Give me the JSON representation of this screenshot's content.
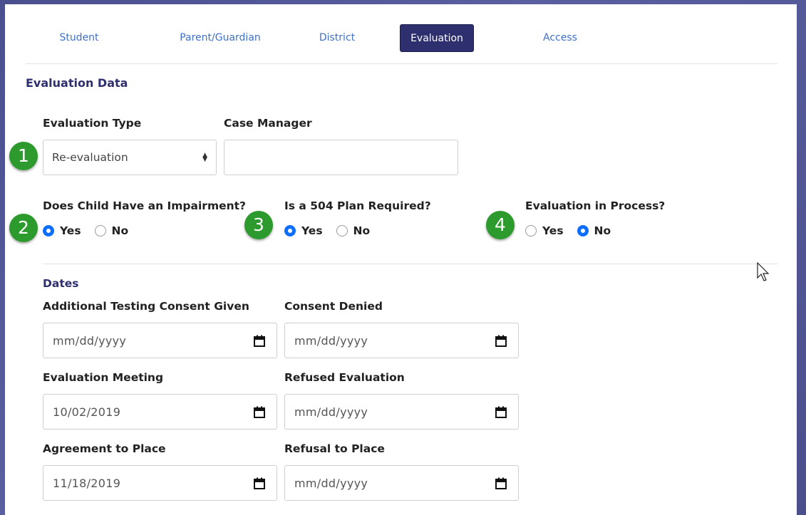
{
  "tabs": [
    "Student",
    "Parent/Guardian",
    "District",
    "Evaluation",
    "Access"
  ],
  "active_tab": "Evaluation",
  "section_title": "Evaluation Data",
  "evaluation_type": {
    "label": "Evaluation Type",
    "value": "Re-evaluation"
  },
  "case_manager": {
    "label": "Case Manager",
    "value": ""
  },
  "badges": [
    "1",
    "2",
    "3",
    "4"
  ],
  "impairment": {
    "label": "Does Child Have an Impairment?",
    "yes": "Yes",
    "no": "No",
    "selected": "Yes"
  },
  "plan504": {
    "label": "Is a 504 Plan Required?",
    "yes": "Yes",
    "no": "No",
    "selected": "Yes"
  },
  "in_process": {
    "label": "Evaluation in Process?",
    "yes": "Yes",
    "no": "No",
    "selected": "No"
  },
  "dates_title": "Dates",
  "dates": {
    "additional_testing": {
      "label": "Additional Testing Consent Given",
      "value": "mm/dd/yyyy"
    },
    "consent_denied": {
      "label": "Consent Denied",
      "value": "mm/dd/yyyy"
    },
    "evaluation_meeting": {
      "label": "Evaluation Meeting",
      "value": "10/02/2019"
    },
    "refused_evaluation": {
      "label": "Refused Evaluation",
      "value": "mm/dd/yyyy"
    },
    "agreement_to_place": {
      "label": "Agreement to Place",
      "value": "11/18/2019"
    },
    "refusal_to_place": {
      "label": "Refusal to Place",
      "value": "mm/dd/yyyy"
    }
  },
  "colors": {
    "accent": "#2e2f6e",
    "link": "#3f71c8",
    "badge": "#2d9a2e",
    "radio": "#0d6efd"
  }
}
